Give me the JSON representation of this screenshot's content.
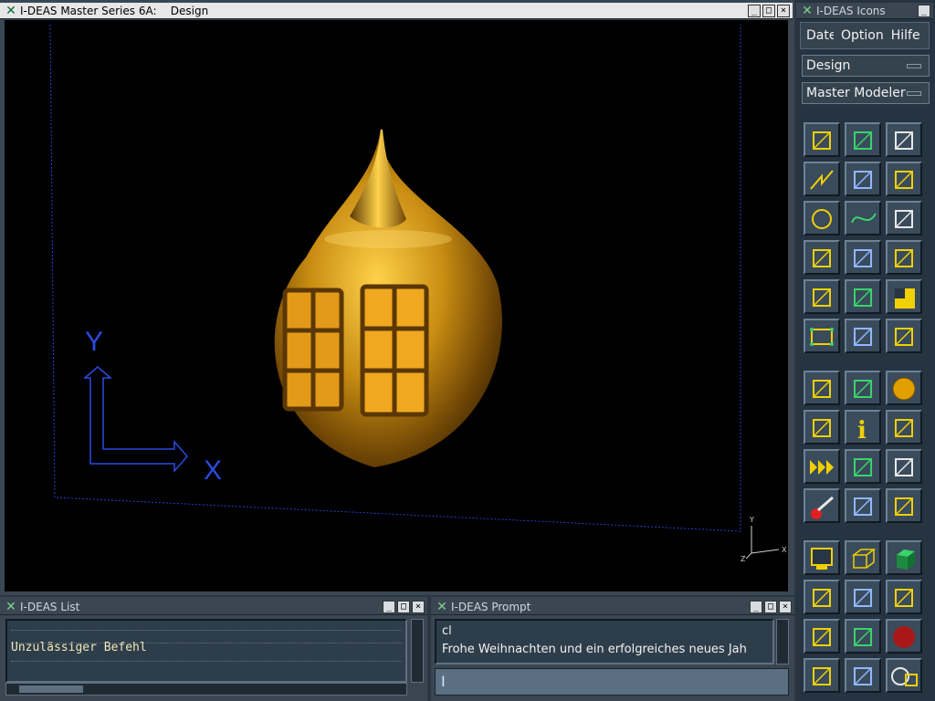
{
  "graphics_window": {
    "title": "I-DEAS Master Series 6A:    Design",
    "buttons": [
      "_",
      "□",
      "×"
    ],
    "axis_labels": {
      "y": "Y",
      "x": "X"
    },
    "triad_labels": {
      "y": "Y",
      "x": "X",
      "z": "Z"
    }
  },
  "icons_panel": {
    "title": "I-DEAS Icons",
    "menu": [
      "Datei",
      "Option",
      "Hilfe"
    ],
    "application": "Design",
    "task": "Master Modeler",
    "icons": [
      "sketch-in-place-icon",
      "workplane-icon",
      "extrude-icon",
      "polyline-icon",
      "spline-points-icon",
      "corner-icon",
      "circle-icon",
      "spline-icon",
      "offset-line-icon",
      "dimension-icon",
      "fillet-curve-icon",
      "surface-patch-icon",
      "hand-modify-icon",
      "surface-fill-icon",
      "section-icon",
      "rectangle-icon",
      "wave-curve-icon",
      "move-icon",
      "node-tree-icon",
      "bounding-box-icon",
      "mesh-sphere-icon",
      "view-frame-icon",
      "info-icon",
      "paint-brush-icon",
      "forward-arrows-icon",
      "ruler-icon",
      "measure-icon",
      "delete-icon",
      "store-icon",
      "library-icon",
      "display-icon",
      "wireframe-cube-icon",
      "shaded-cube-icon",
      "zoom-box-icon",
      "fit-view-icon",
      "eye-view-icon",
      "front-view-icon",
      "isometric-view-icon",
      "stop-icon",
      "side-view-icon",
      "top-view-icon",
      "save-disk-icon"
    ]
  },
  "list_window": {
    "title": "I-DEAS List",
    "message": "Unzulässiger Befehl"
  },
  "prompt_window": {
    "title": "I-DEAS Prompt",
    "lines": [
      "cl",
      "Frohe Weihnachten und ein erfolgreiches neues Jah"
    ],
    "input_value": ""
  }
}
